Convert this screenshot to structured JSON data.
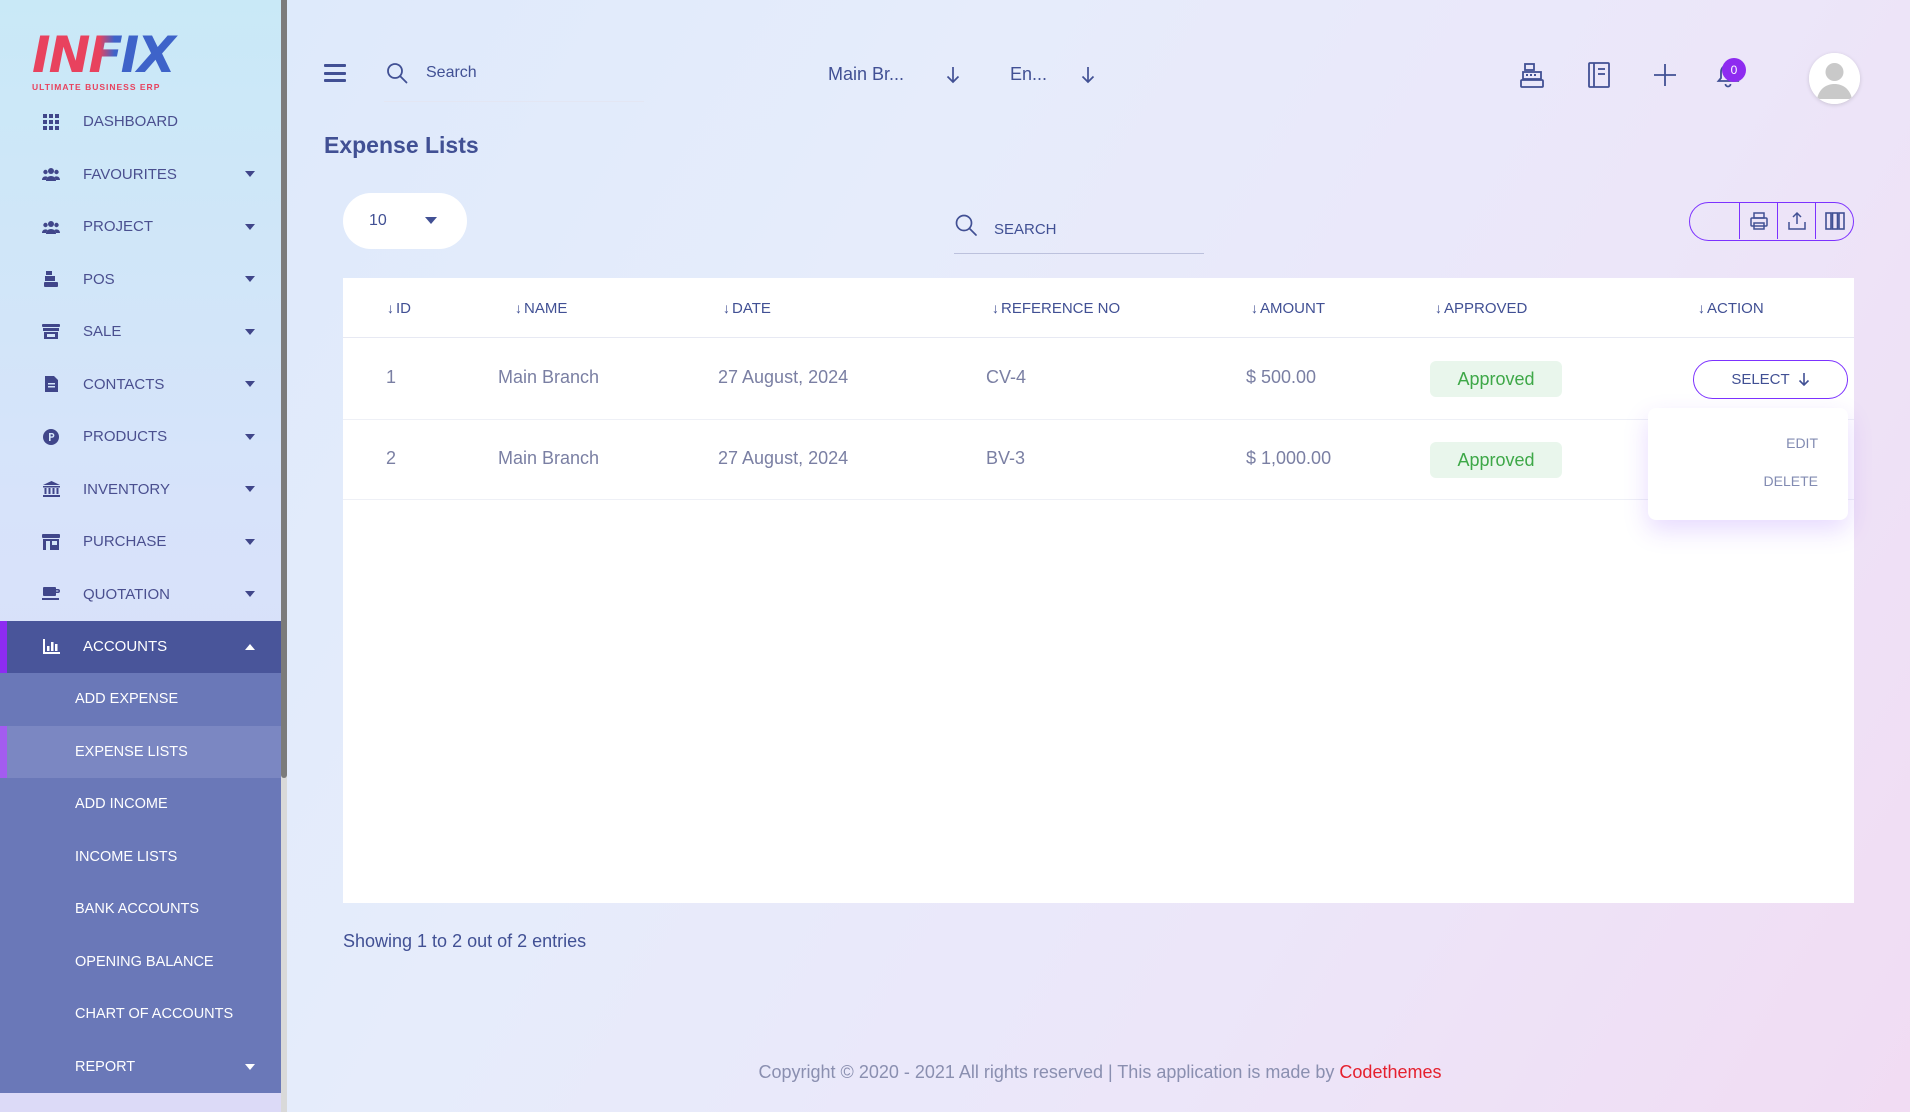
{
  "brand": {
    "logo_text": "INFIX",
    "tagline": "ULTIMATE BUSINESS ERP"
  },
  "sidebar": {
    "items": [
      {
        "label": "DASHBOARD",
        "icon": "grid-icon"
      },
      {
        "label": "FAVOURITES",
        "icon": "users-icon"
      },
      {
        "label": "PROJECT",
        "icon": "users-icon"
      },
      {
        "label": "POS",
        "icon": "cash-register-icon"
      },
      {
        "label": "SALE",
        "icon": "store-icon"
      },
      {
        "label": "CONTACTS",
        "icon": "contact-book-icon"
      },
      {
        "label": "PRODUCTS",
        "icon": "product-badge-icon"
      },
      {
        "label": "INVENTORY",
        "icon": "bank-icon"
      },
      {
        "label": "PURCHASE",
        "icon": "shop-icon"
      },
      {
        "label": "QUOTATION",
        "icon": "coffee-icon"
      },
      {
        "label": "ACCOUNTS",
        "icon": "chart-icon"
      }
    ],
    "sub_items": [
      {
        "label": "ADD EXPENSE"
      },
      {
        "label": "EXPENSE LISTS"
      },
      {
        "label": "ADD INCOME"
      },
      {
        "label": "INCOME LISTS"
      },
      {
        "label": "BANK ACCOUNTS"
      },
      {
        "label": "OPENING BALANCE"
      },
      {
        "label": "CHART OF ACCOUNTS"
      },
      {
        "label": "REPORT"
      }
    ]
  },
  "topbar": {
    "search_placeholder": "Search",
    "branch": "Main Br...",
    "language": "En...",
    "notification_count": "0"
  },
  "page": {
    "title": "Expense Lists"
  },
  "table_controls": {
    "page_size": "10",
    "search_placeholder": "SEARCH"
  },
  "table": {
    "headers": [
      "ID",
      "NAME",
      "DATE",
      "REFERENCE NO",
      "AMOUNT",
      "APPROVED",
      "ACTION"
    ],
    "rows": [
      {
        "id": "1",
        "name": "Main Branch",
        "date": "27 August, 2024",
        "ref": "CV-4",
        "amount": "$ 500.00",
        "status": "Approved"
      },
      {
        "id": "2",
        "name": "Main Branch",
        "date": "27 August, 2024",
        "ref": "BV-3",
        "amount": "$ 1,000.00",
        "status": "Approved"
      }
    ],
    "action_label": "SELECT",
    "action_menu": [
      "EDIT",
      "DELETE"
    ]
  },
  "pagination": {
    "summary": "Showing 1 to 2 out of 2 entries"
  },
  "footer": {
    "text": "Copyright © 2020 - 2021 All rights reserved | This application is made by ",
    "link": "Codethemes"
  },
  "colors": {
    "primary": "#415094",
    "accent": "#7c32ff",
    "badge": "#8e2bf0",
    "active_menu": "#49559a",
    "submenu": "#6a78b8",
    "approved_text": "#3ea848",
    "approved_bg": "#e9f6ec",
    "footer_link": "#e5202e"
  }
}
